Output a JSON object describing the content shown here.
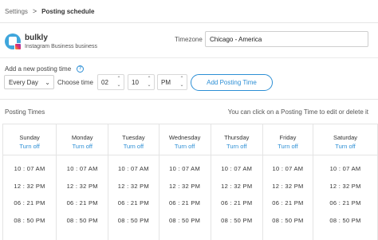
{
  "breadcrumb": {
    "parent": "Settings",
    "separator": ">",
    "current": "Posting schedule"
  },
  "account": {
    "name": "bulkly",
    "type": "Instagram Business business"
  },
  "timezone": {
    "label": "Timezone",
    "value": "Chicago - America"
  },
  "add_posting": {
    "label": "Add a new posting time",
    "help": "?",
    "day_value": "Every Day",
    "choose_label": "Choose time",
    "hour": "02",
    "minute": "10",
    "ampm": "PM",
    "button_label": "Add Posting Time"
  },
  "posting_times": {
    "title": "Posting Times",
    "hint": "You can click on a Posting Time to edit or delete it",
    "turn_off_label": "Turn off",
    "days": [
      {
        "name": "Sunday",
        "times": [
          "10 : 07  AM",
          "12 : 32  PM",
          "06 : 21  PM",
          "08 : 50  PM"
        ]
      },
      {
        "name": "Monday",
        "times": [
          "10 : 07  AM",
          "12 : 32  PM",
          "06 : 21  PM",
          "08 : 50  PM"
        ]
      },
      {
        "name": "Tuesday",
        "times": [
          "10 : 07  AM",
          "12 : 32  PM",
          "06 : 21  PM",
          "08 : 50  PM"
        ]
      },
      {
        "name": "Wednesday",
        "times": [
          "10 : 07  AM",
          "12 : 32  PM",
          "06 : 21  PM",
          "08 : 50  PM"
        ]
      },
      {
        "name": "Thursday",
        "times": [
          "10 : 07  AM",
          "12 : 32  PM",
          "06 : 21  PM",
          "08 : 50  PM"
        ]
      },
      {
        "name": "Friday",
        "times": [
          "10 : 07  AM",
          "12 : 32  PM",
          "06 : 21  PM",
          "08 : 50  PM"
        ]
      },
      {
        "name": "Saturday",
        "times": [
          "10 : 07  AM",
          "12 : 32  PM",
          "06 : 21  PM",
          "08 : 50  PM"
        ]
      }
    ]
  },
  "colors": {
    "accent": "#2d8fd5",
    "avatar": "#3fa6dc",
    "border": "#e4e4e4"
  },
  "icons": {
    "help": "help-icon",
    "chevron": "chevron-down-icon",
    "breadcrumb_sep": "chevron-right-icon"
  }
}
